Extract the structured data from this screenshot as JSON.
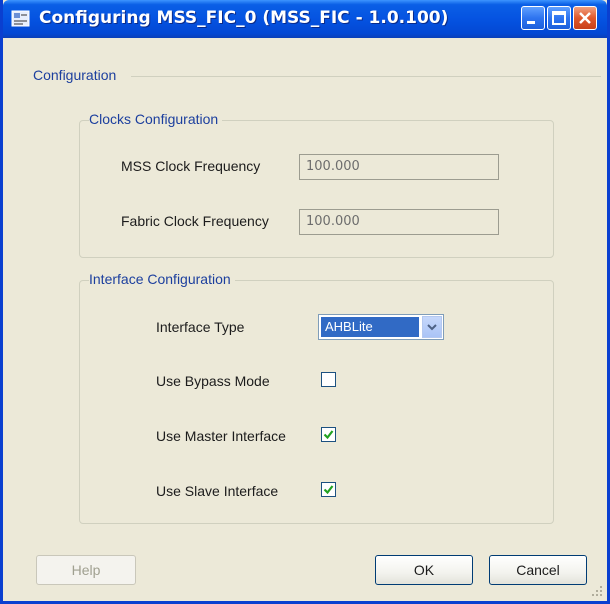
{
  "window": {
    "title": "Configuring MSS_FIC_0 (MSS_FIC - 1.0.100)"
  },
  "configuration": {
    "title": "Configuration"
  },
  "clocks": {
    "title": "Clocks Configuration",
    "mss_label": "MSS Clock Frequency",
    "mss_value": "100.000",
    "fabric_label": "Fabric Clock Frequency",
    "fabric_value": "100.000"
  },
  "interface": {
    "title": "Interface Configuration",
    "type_label": "Interface Type",
    "type_value": "AHBLite",
    "bypass_label": "Use Bypass Mode",
    "bypass_checked": false,
    "master_label": "Use Master Interface",
    "master_checked": true,
    "slave_label": "Use Slave Interface",
    "slave_checked": true
  },
  "buttons": {
    "help": "Help",
    "ok": "OK",
    "cancel": "Cancel"
  },
  "colors": {
    "titlebar": "#0553e1",
    "group_title": "#1c3f9e",
    "selection": "#316ac5",
    "checkmark": "#21a121"
  }
}
